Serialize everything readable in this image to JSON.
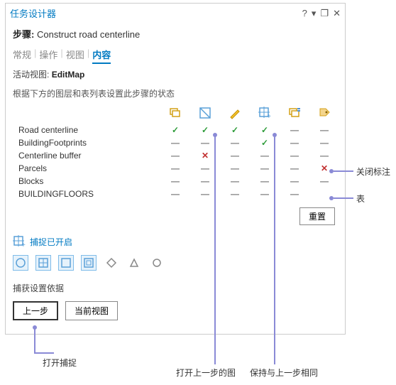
{
  "window": {
    "title": "任务设计器",
    "help_icon": "?",
    "dropdown_icon": "▾",
    "restore_icon": "❐",
    "close_icon": "✕"
  },
  "step": {
    "label": "步骤:",
    "value": "Construct road centerline"
  },
  "tabs": {
    "general": "常规",
    "actions": "操作",
    "views": "视图",
    "contents": "内容"
  },
  "active_view": {
    "label": "活动视图:",
    "value": "EditMap"
  },
  "description": "根据下方的图层和表列表设置此步骤的状态",
  "columns": [
    "layers-icon",
    "visibility-icon",
    "editable-icon",
    "snappable-icon",
    "selectable-icon",
    "label-icon"
  ],
  "rows": [
    {
      "name": "Road centerline",
      "cells": [
        "check",
        "check",
        "check",
        "check",
        "dash",
        "dash"
      ]
    },
    {
      "name": "BuildingFootprints",
      "cells": [
        "dash",
        "dash",
        "dash",
        "check",
        "dash",
        "dash"
      ]
    },
    {
      "name": "Centerline buffer",
      "cells": [
        "dash",
        "cross",
        "dash",
        "dash",
        "dash",
        "dash"
      ]
    },
    {
      "name": "Parcels",
      "cells": [
        "dash",
        "dash",
        "dash",
        "dash",
        "dash",
        "cross"
      ]
    },
    {
      "name": "Blocks",
      "cells": [
        "dash",
        "dash",
        "dash",
        "dash",
        "dash",
        "dash"
      ]
    },
    {
      "name": "BUILDINGFLOORS",
      "cells": [
        "dash",
        "dash",
        "dash",
        "dash",
        "dash",
        ""
      ]
    }
  ],
  "reset_button": "重置",
  "snapping": {
    "label": "捕捉已开启"
  },
  "snap_basis_label": "捕获设置依据",
  "bottom_buttons": {
    "prev": "上一步",
    "current_view": "当前视图"
  },
  "callouts": {
    "close_label": "关闭标注",
    "table": "表",
    "open_snap": "打开捕捉",
    "open_prev_map": "打开上一步的图",
    "keep_same": "保持与上一步相同"
  }
}
